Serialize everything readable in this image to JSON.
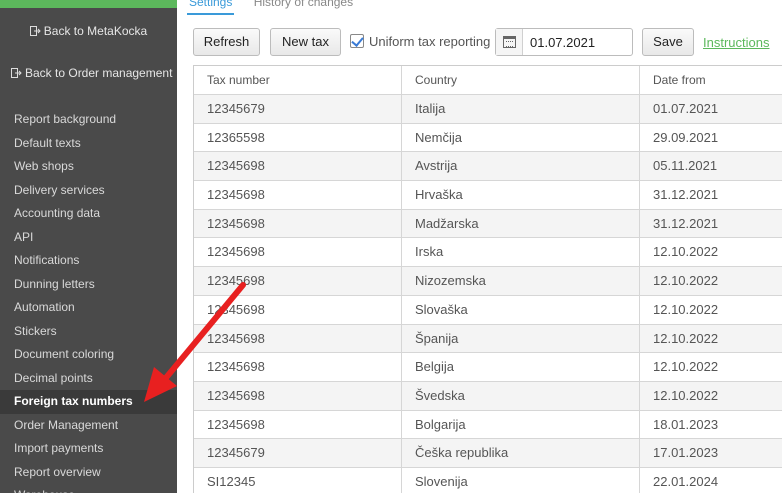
{
  "sidebar": {
    "back_metakocka": "Back to MetaKocka",
    "back_order": "Back to Order management",
    "items": [
      {
        "label": "Report background"
      },
      {
        "label": "Default texts"
      },
      {
        "label": "Web shops"
      },
      {
        "label": "Delivery services"
      },
      {
        "label": "Accounting data"
      },
      {
        "label": "API"
      },
      {
        "label": "Notifications"
      },
      {
        "label": "Dunning letters"
      },
      {
        "label": "Automation"
      },
      {
        "label": "Stickers"
      },
      {
        "label": "Document coloring"
      },
      {
        "label": "Decimal points"
      },
      {
        "label": "Foreign tax numbers",
        "active": true
      },
      {
        "label": "Order Management"
      },
      {
        "label": "Import payments"
      },
      {
        "label": "Report overview"
      },
      {
        "label": "Warehouse"
      }
    ]
  },
  "tabs": {
    "settings": "Settings",
    "history": "History of changes"
  },
  "toolbar": {
    "refresh": "Refresh",
    "new_tax": "New tax",
    "uniform_label": "Uniform tax reporting",
    "uniform_checked": true,
    "date_value": "01.07.2021",
    "save": "Save",
    "instructions": "Instructions"
  },
  "table": {
    "headers": [
      "Tax number",
      "Country",
      "Date from"
    ],
    "rows": [
      [
        "12345679",
        "Italija",
        "01.07.2021"
      ],
      [
        "12365598",
        "Nemčija",
        "29.09.2021"
      ],
      [
        "12345698",
        "Avstrija",
        "05.11.2021"
      ],
      [
        "12345698",
        "Hrvaška",
        "31.12.2021"
      ],
      [
        "12345698",
        "Madžarska",
        "31.12.2021"
      ],
      [
        "12345698",
        "Irska",
        "12.10.2022"
      ],
      [
        "12345698",
        "Nizozemska",
        "12.10.2022"
      ],
      [
        "12345698",
        "Slovaška",
        "12.10.2022"
      ],
      [
        "12345698",
        "Španija",
        "12.10.2022"
      ],
      [
        "12345698",
        "Belgija",
        "12.10.2022"
      ],
      [
        "12345698",
        "Švedska",
        "12.10.2022"
      ],
      [
        "12345698",
        "Bolgarija",
        "18.01.2023"
      ],
      [
        "12345679",
        "Češka republika",
        "17.01.2023"
      ],
      [
        "SI12345",
        "Slovenija",
        "22.01.2024"
      ]
    ]
  },
  "colors": {
    "sidebar_bg": "#4a4a4a",
    "accent_green": "#5cb85c",
    "tab_active": "#3a9ad9",
    "arrow": "#e82020"
  }
}
